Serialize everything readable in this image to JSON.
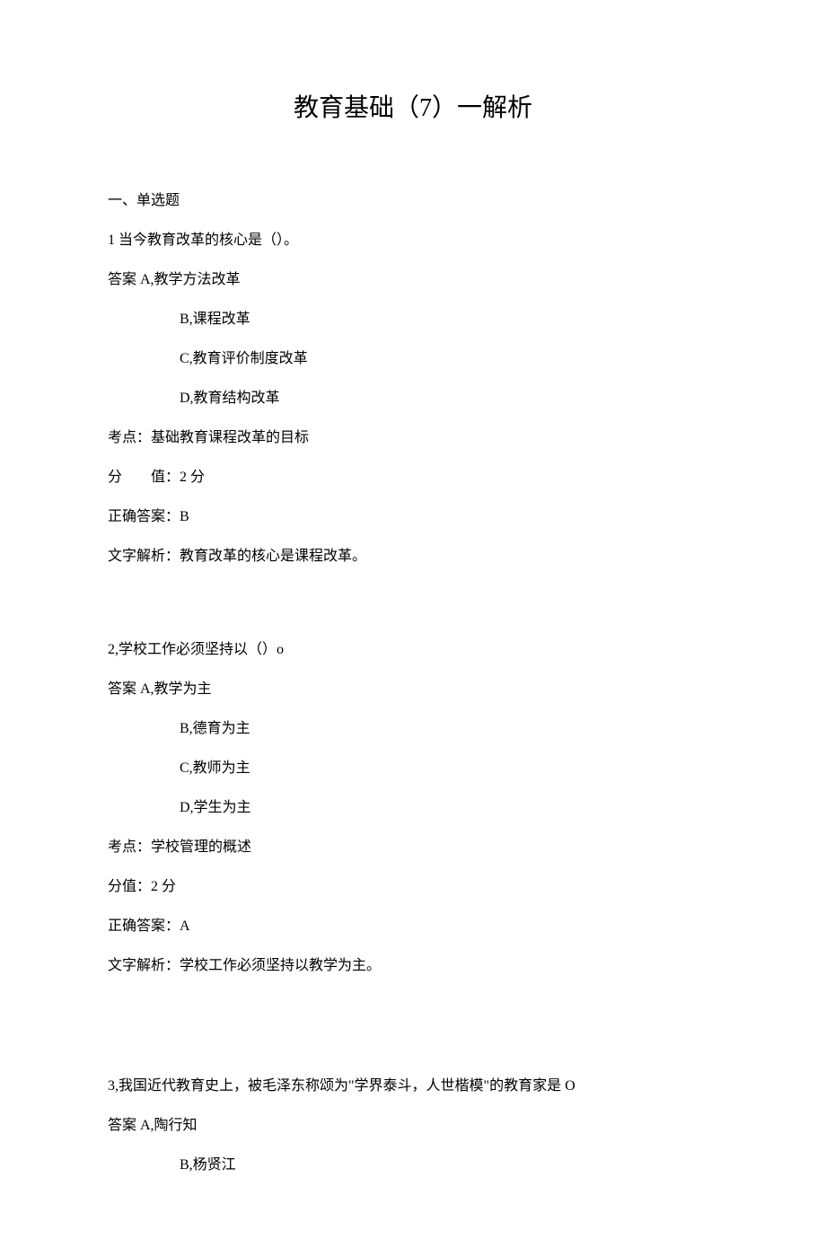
{
  "title": "教育基础（7）一解析",
  "section_header": "一、单选题",
  "q1": {
    "stem": "1 当今教育改革的核心是（）。",
    "answer_label": "答案 A,教学方法改革",
    "opt_b": "B,课程改革",
    "opt_c": "C,教育评价制度改革",
    "opt_d": "D,教育结构改革",
    "point": "考点：基础教育课程改革的目标",
    "score": "分  值：2 分",
    "correct": "正确答案：B",
    "explain": "文字解析：教育改革的核心是课程改革。"
  },
  "q2": {
    "stem": "2,学校工作必须坚持以（）o",
    "answer_label": "答案 A,教学为主",
    "opt_b": "B,德育为主",
    "opt_c": "C,教师为主",
    "opt_d": "D,学生为主",
    "point": "考点：学校管理的概述",
    "score": "分值：2 分",
    "correct": "正确答案：A",
    "explain": "文字解析：学校工作必须坚持以教学为主。"
  },
  "q3": {
    "stem": "3,我国近代教育史上，被毛泽东称颂为\"学界泰斗，人世楷模\"的教育家是 O",
    "answer_label": "答案 A,陶行知",
    "opt_b": "B,杨贤江"
  }
}
